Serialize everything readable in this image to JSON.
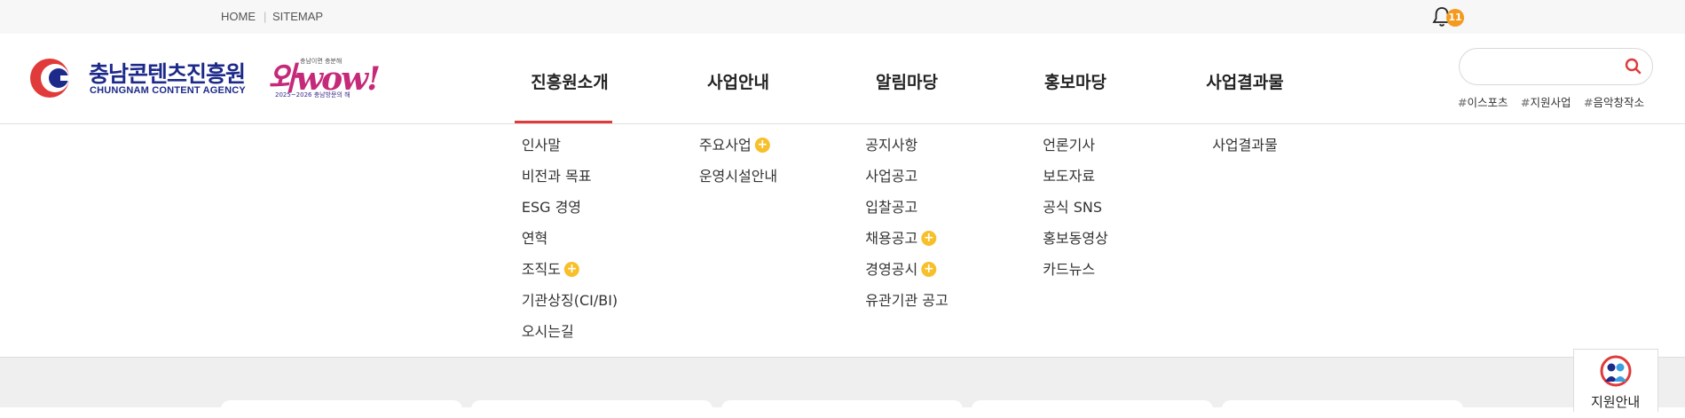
{
  "utility": {
    "home": "HOME",
    "separator": "|",
    "sitemap": "SITEMAP",
    "notification_count": "11"
  },
  "logo": {
    "ko": "충남콘텐츠진흥원",
    "en": "CHUNGNAM CONTENT AGENCY"
  },
  "campaign": {
    "tagline": "충남이면 충분해",
    "word": "와wow!",
    "years": "2025~2026 충남방문의 해"
  },
  "nav": [
    "진흥원소개",
    "사업안내",
    "알림마당",
    "홍보마당",
    "사업결과물"
  ],
  "search": {
    "placeholder": "",
    "value": ""
  },
  "tags": [
    "이스포츠",
    "지원사업",
    "음악창작소"
  ],
  "submenu": [
    {
      "items": [
        {
          "label": "인사말"
        },
        {
          "label": "비전과 목표"
        },
        {
          "label": "ESG 경영"
        },
        {
          "label": "연혁"
        },
        {
          "label": "조직도",
          "expand": true
        },
        {
          "label": "기관상징(CI/BI)"
        },
        {
          "label": "오시는길"
        }
      ]
    },
    {
      "items": [
        {
          "label": "주요사업",
          "expand": true
        },
        {
          "label": "운영시설안내"
        }
      ]
    },
    {
      "items": [
        {
          "label": "공지사항"
        },
        {
          "label": "사업공고"
        },
        {
          "label": "입찰공고"
        },
        {
          "label": "채용공고",
          "expand": true
        },
        {
          "label": "경영공시",
          "expand": true
        },
        {
          "label": "유관기관 공고"
        }
      ]
    },
    {
      "items": [
        {
          "label": "언론기사"
        },
        {
          "label": "보도자료"
        },
        {
          "label": "공식 SNS"
        },
        {
          "label": "홍보동영상"
        },
        {
          "label": "카드뉴스"
        }
      ]
    },
    {
      "items": [
        {
          "label": "사업결과물"
        }
      ]
    }
  ],
  "side_widget": {
    "label": "지원안내"
  },
  "colors": {
    "brand_blue": "#1d2a8a",
    "accent_red": "#e03a3a",
    "badge_orange": "#f39a1f",
    "plus_yellow": "#f7c02a"
  }
}
